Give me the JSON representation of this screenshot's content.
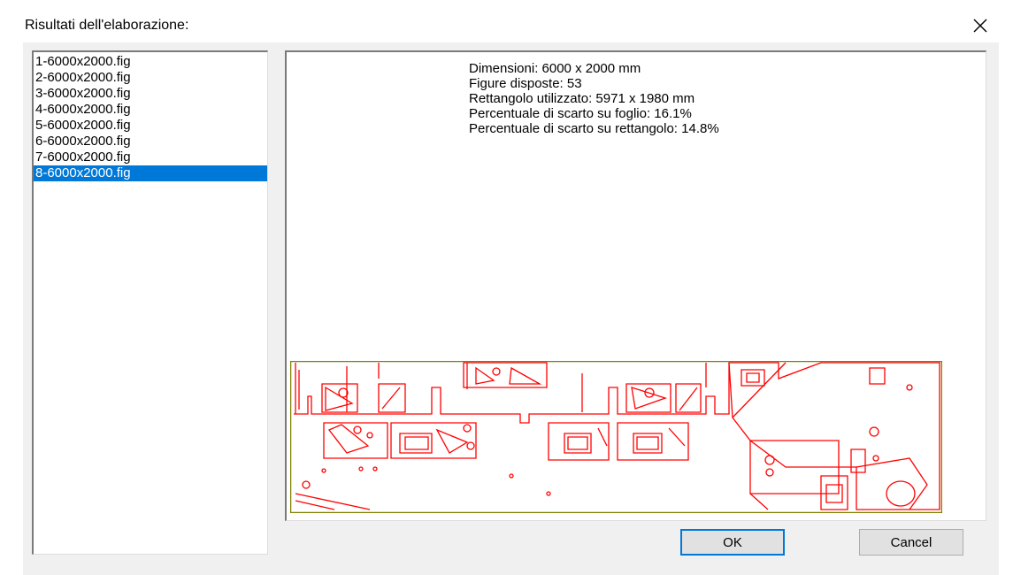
{
  "window": {
    "title": "Risultati dell'elaborazione:"
  },
  "icons": {
    "close": "close-icon"
  },
  "file_list": {
    "items": [
      "1-6000x2000.fig",
      "2-6000x2000.fig",
      "3-6000x2000.fig",
      "4-6000x2000.fig",
      "5-6000x2000.fig",
      "6-6000x2000.fig",
      "7-6000x2000.fig",
      "8-6000x2000.fig"
    ],
    "selected_index": 7
  },
  "info": {
    "lines": [
      "Dimensioni: 6000 x 2000 mm",
      "Figure disposte: 53",
      "Rettangolo utilizzato: 5971 x 1980 mm",
      "Percentuale di scarto su foglio: 16.1%",
      "Percentuale di scarto su rettangolo: 14.8%"
    ]
  },
  "buttons": {
    "ok": "OK",
    "cancel": "Cancel"
  },
  "colors": {
    "selection": "#0078d7",
    "figure_outline": "#ff0000",
    "sheet_border": "#808000"
  }
}
